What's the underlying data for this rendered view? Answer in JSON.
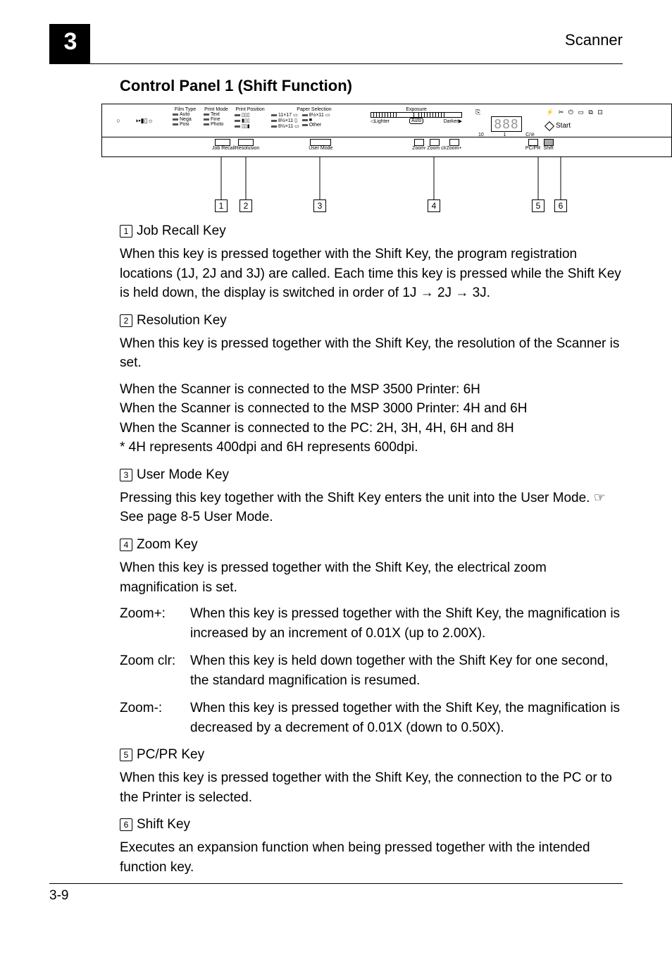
{
  "header": {
    "chapter": "3",
    "right": "Scanner"
  },
  "section_title": "Control Panel 1 (Shift Function)",
  "panel": {
    "film_type": {
      "header": "Film Type",
      "items": [
        "Auto",
        "Nega",
        "Posi"
      ]
    },
    "print_mode": {
      "header": "Print Mode",
      "items": [
        "Text",
        "Fine",
        "Photo"
      ]
    },
    "print_position": {
      "header": "Print Position"
    },
    "paper_selection": {
      "header": "Paper Selection",
      "items": [
        "11×17",
        "8½×11",
        "8½×11",
        "8½×11",
        "8½×11",
        "Other"
      ]
    },
    "exposure": {
      "header": "Exposure",
      "lighter": "Lighter",
      "auto": "Auto",
      "darker": "Darker"
    },
    "counter": {
      "digits": "888",
      "ten": "10",
      "one": "1",
      "stop": "C/"
    },
    "start": "Start",
    "lower": {
      "job_recall": "Job Recall",
      "resolusion": "Resolusion",
      "user_mode": "User Mode",
      "zoom_m": "Zoom-",
      "zoom_clr": "Zoom clr",
      "zoom_p": "Zoom+",
      "pcpr": "PC/PR",
      "shift": "Shift"
    }
  },
  "keys": [
    {
      "num": "1",
      "title": "Job Recall Key",
      "paras": [
        "When this key is pressed together with the Shift Key, the program registration locations (1J, 2J and 3J) are called. Each time this key is pressed while the Shift Key is held down, the display is switched in order of 1J → 2J → 3J."
      ]
    },
    {
      "num": "2",
      "title": "Resolution Key",
      "paras": [
        "When this key is pressed together with the Shift Key, the resolution of the Scanner is set.",
        "When the Scanner is connected to the MSP 3500 Printer: 6H\nWhen the Scanner is connected to the MSP 3000 Printer: 4H and 6H\nWhen the Scanner is connected to the PC: 2H, 3H, 4H, 6H and 8H\n* 4H represents 400dpi and 6H represents 600dpi."
      ]
    },
    {
      "num": "3",
      "title": "User Mode Key",
      "paras": [
        "Pressing this key together with the Shift Key enters the unit into the User Mode. ☞ See page 8-5 User Mode."
      ]
    },
    {
      "num": "4",
      "title": "Zoom Key",
      "paras": [
        "When this key is pressed together with the Shift Key, the electrical zoom magnification is set."
      ],
      "zooms": [
        {
          "label": "Zoom+:",
          "text": "When this key is pressed together with the Shift Key, the magnification is increased by an increment of 0.01X (up to 2.00X)."
        },
        {
          "label": "Zoom clr:",
          "text": "When this key is held down together with the Shift Key for one second, the standard magnification is resumed."
        },
        {
          "label": "Zoom-:",
          "text": "When this key is pressed together with the Shift Key, the magnification is decreased by a decrement of 0.01X (down to 0.50X)."
        }
      ]
    },
    {
      "num": "5",
      "title": "PC/PR Key",
      "paras": [
        "When this key is pressed together with the Shift Key, the connection to the PC or to the Printer is selected."
      ]
    },
    {
      "num": "6",
      "title": "Shift Key",
      "paras": [
        "Executes an expansion function when being pressed together with the intended function key."
      ]
    }
  ],
  "footer": "3-9"
}
